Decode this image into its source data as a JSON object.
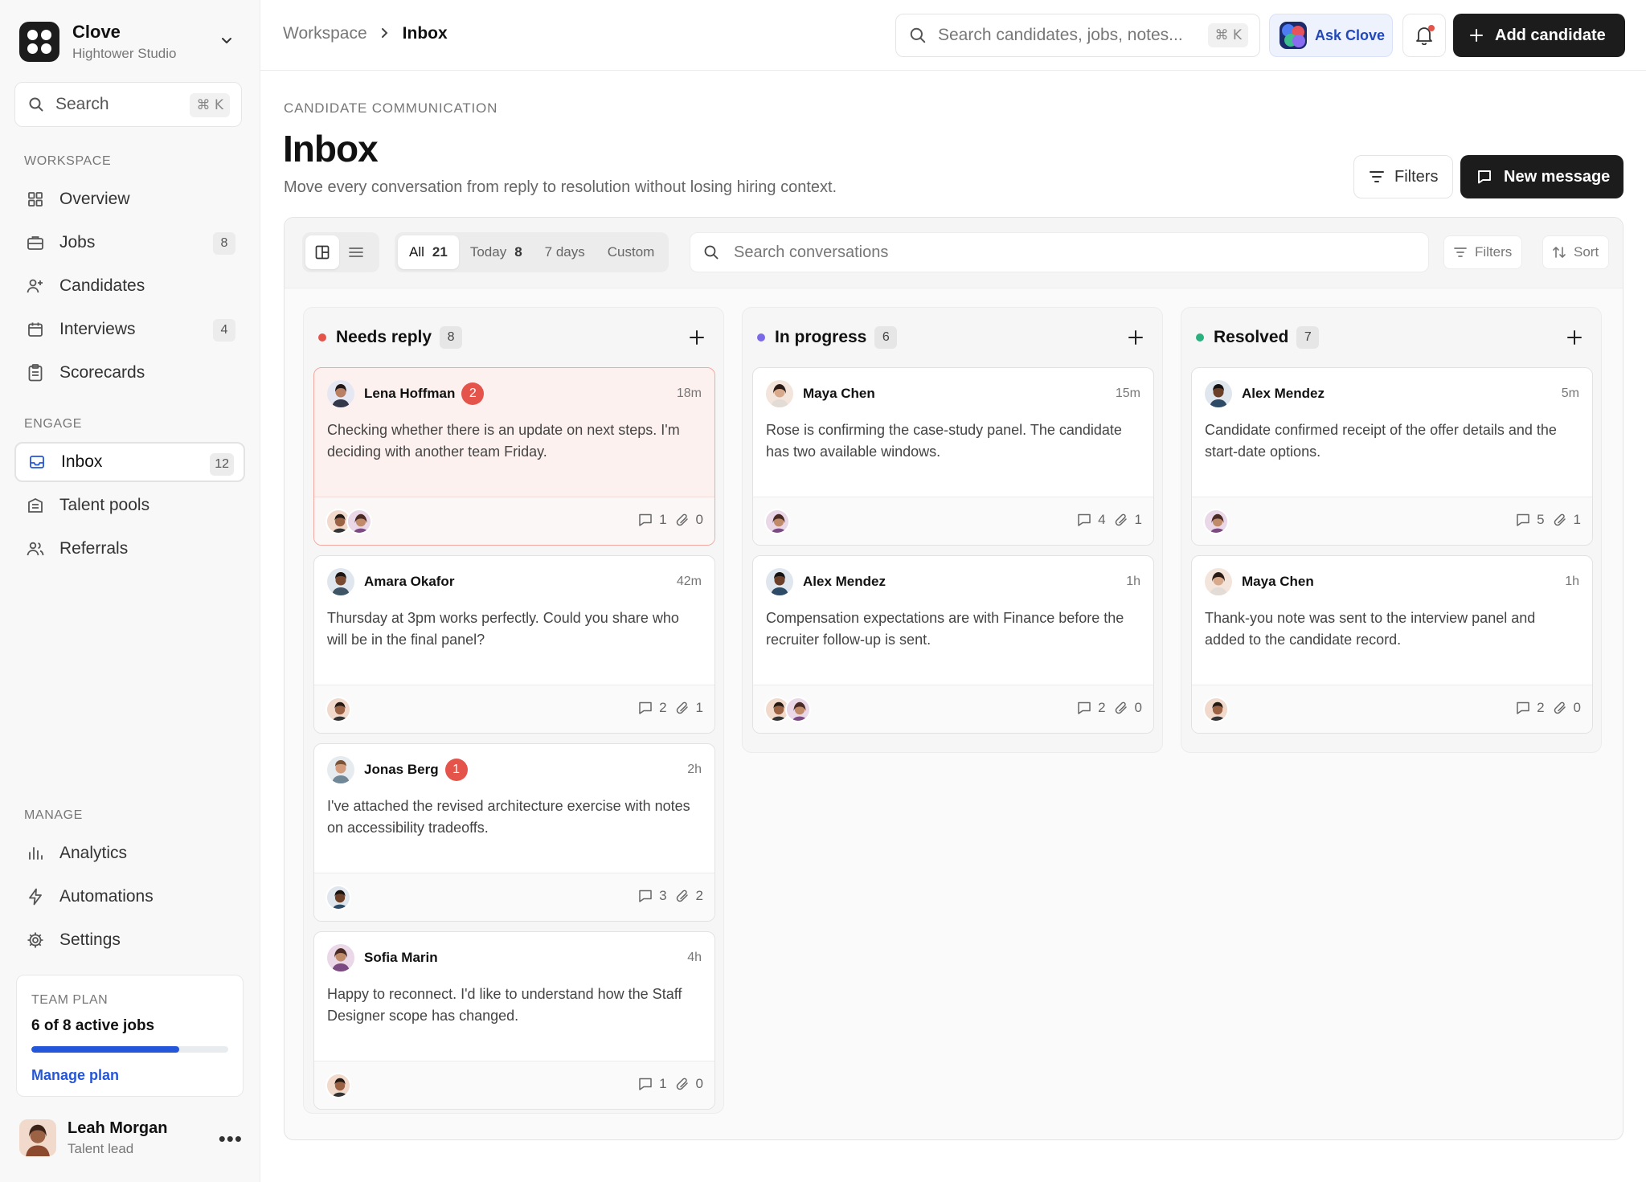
{
  "brand": {
    "name": "Clove",
    "workspace": "Hightower Studio"
  },
  "sidebar": {
    "search_label": "Search",
    "search_shortcut": "⌘ K",
    "workspace_title": "WORKSPACE",
    "engage_title": "ENGAGE",
    "manage_title": "MANAGE",
    "items": [
      {
        "label": "Overview",
        "icon": "grid-icon"
      },
      {
        "label": "Jobs",
        "icon": "briefcase-icon",
        "count": "8"
      },
      {
        "label": "Candidates",
        "icon": "user-plus-icon"
      },
      {
        "label": "Interviews",
        "icon": "calendar-icon",
        "count": "4"
      },
      {
        "label": "Scorecards",
        "icon": "clipboard-icon"
      },
      {
        "label": "Inbox",
        "icon": "inbox-icon",
        "count": "12",
        "active": true
      },
      {
        "label": "Talent pools",
        "icon": "building-icon"
      },
      {
        "label": "Referrals",
        "icon": "users-icon"
      },
      {
        "label": "Analytics",
        "icon": "bar-chart-icon"
      },
      {
        "label": "Automations",
        "icon": "bolt-icon"
      },
      {
        "label": "Settings",
        "icon": "gear-icon"
      }
    ],
    "plan": {
      "title": "TEAM PLAN",
      "jobs_text": "6 of 8 active jobs",
      "used": 6,
      "total": 8,
      "link": "Manage plan"
    },
    "user": {
      "name": "Leah Morgan",
      "role": "Talent lead"
    }
  },
  "topbar": {
    "breadcrumb": [
      "Workspace",
      "Inbox"
    ],
    "search_placeholder": "Search candidates, jobs, notes...",
    "search_shortcut": "⌘ K",
    "ask_label": "Ask Clove",
    "add_label": "Add candidate"
  },
  "header": {
    "eyebrow": "CANDIDATE COMMUNICATION",
    "title": "Inbox",
    "description": "Move every conversation from reply to resolution without losing hiring context.",
    "filters_label": "Filters",
    "new_message_label": "New message"
  },
  "toolbar": {
    "ranges": [
      {
        "label": "All",
        "count": "21",
        "active": true
      },
      {
        "label": "Today",
        "count": "8"
      },
      {
        "label": "7 days"
      },
      {
        "label": "Custom"
      }
    ],
    "search_placeholder": "Search conversations",
    "filters_label": "Filters",
    "sort_label": "Sort"
  },
  "colors": {
    "accent": "#2456d9",
    "needs_reply": "#e5544a",
    "in_progress": "#7b6ae8",
    "resolved": "#2bb07f",
    "dark": "#1c1c1c"
  },
  "columns": [
    {
      "title": "Needs reply",
      "count": "8",
      "cards": [
        {
          "name": "Lena Hoffman",
          "badge": "2",
          "time": "18m",
          "text": "Checking whether there is an update on next steps. I'm deciding with another team Friday.",
          "comments": "1",
          "attachments": "0"
        },
        {
          "name": "Amara Okafor",
          "time": "42m",
          "text": "Thursday at 3pm works perfectly. Could you share who will be in the final panel?",
          "comments": "2",
          "attachments": "1"
        },
        {
          "name": "Jonas Berg",
          "badge": "1",
          "time": "2h",
          "text": "I've attached the revised architecture exercise with notes on accessibility tradeoffs.",
          "comments": "3",
          "attachments": "2"
        },
        {
          "name": "Sofia Marin",
          "time": "4h",
          "text": "Happy to reconnect. I'd like to understand how the Staff Designer scope has changed.",
          "comments": "1",
          "attachments": "0"
        }
      ]
    },
    {
      "title": "In progress",
      "count": "6",
      "cards": [
        {
          "name": "Maya Chen",
          "time": "15m",
          "text": "Rose is confirming the case-study panel. The candidate has two available windows.",
          "comments": "4",
          "attachments": "1"
        },
        {
          "name": "Alex Mendez",
          "time": "1h",
          "text": "Compensation expectations are with Finance before the recruiter follow-up is sent.",
          "comments": "2",
          "attachments": "0"
        }
      ]
    },
    {
      "title": "Resolved",
      "count": "7",
      "cards": [
        {
          "name": "Alex Mendez",
          "time": "5m",
          "text": "Candidate confirmed receipt of the offer details and the start-date options.",
          "comments": "5",
          "attachments": "1"
        },
        {
          "name": "Maya Chen",
          "time": "1h",
          "text": "Thank-you note was sent to the interview panel and added to the candidate record.",
          "comments": "2",
          "attachments": "0"
        }
      ]
    }
  ]
}
